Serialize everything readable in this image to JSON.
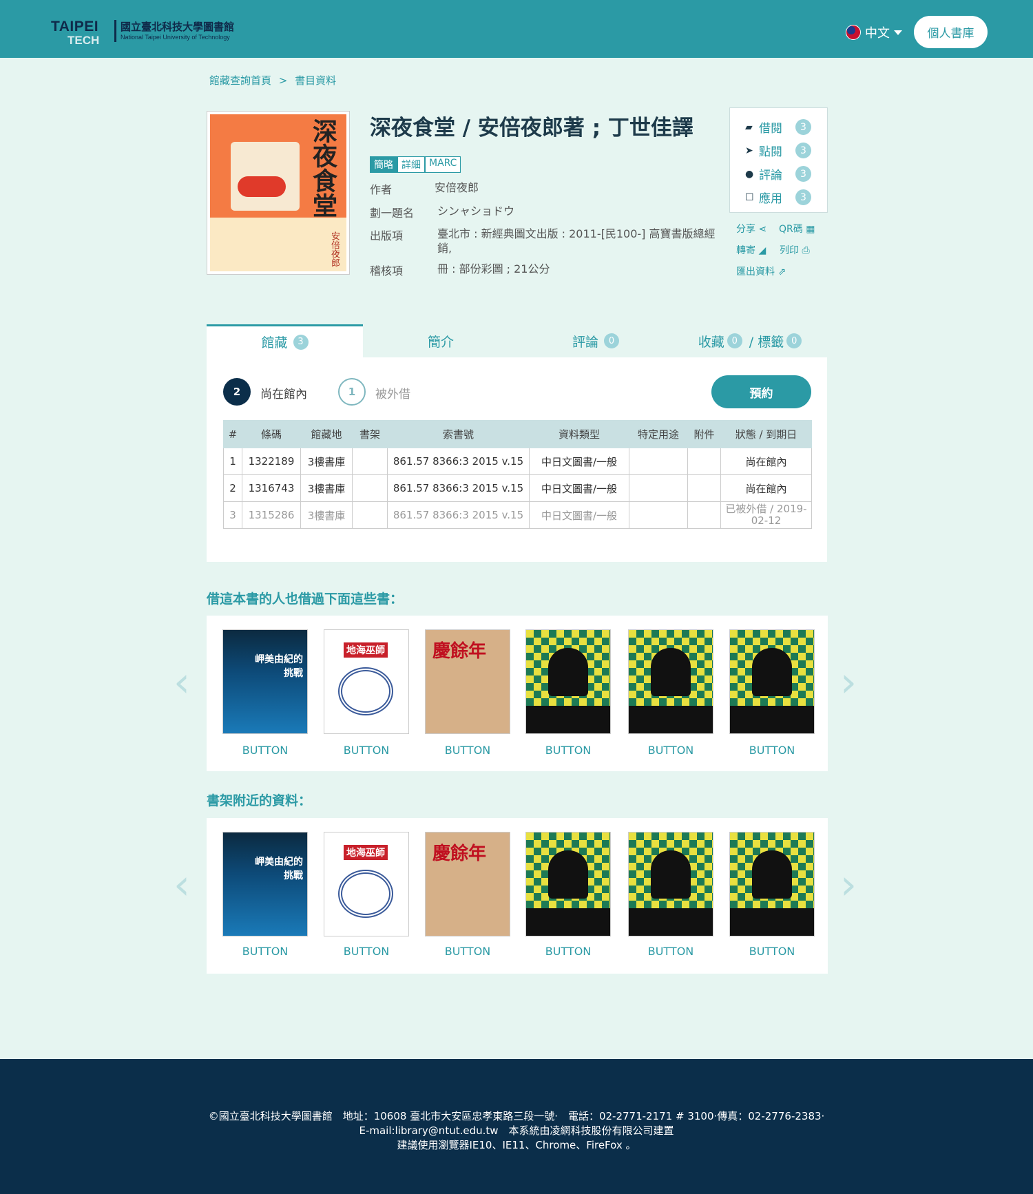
{
  "header": {
    "logo_text": "TAIPEI",
    "logo_text2": "TECH",
    "logo_zh": "國立臺北科技大學圖書館",
    "logo_en": "National Taipei University of Technology",
    "lang": "中文",
    "my_library": "個人書庫"
  },
  "breadcrumb": {
    "home": "館藏查詢首頁",
    "sep": ">",
    "current": "書目資料"
  },
  "book": {
    "cover_title": "深夜食堂",
    "cover_author": "安倍夜郎",
    "title": "深夜食堂 / 安倍夜郎著 ; 丁世佳譯",
    "view_tabs": [
      "簡略",
      "詳細",
      "MARC"
    ],
    "fields": [
      {
        "key": "作者",
        "value": "安倍夜郎"
      },
      {
        "key": "劃一題名",
        "value": "シンャショドウ"
      },
      {
        "key": "出版項",
        "value": "臺北市 : 新經典圖文出版 : 2011-[民100-] 高寶書版總經銷,"
      },
      {
        "key": "稽核項",
        "value": "冊 : 部份彩圖 ; 21公分"
      }
    ]
  },
  "side_stats": [
    {
      "label": "借閱",
      "count": "3",
      "icon": "book-icon"
    },
    {
      "label": "點閱",
      "count": "3",
      "icon": "cursor-icon"
    },
    {
      "label": "評論",
      "count": "3",
      "icon": "comment-icon"
    },
    {
      "label": "應用",
      "count": "3",
      "icon": "square-icon"
    }
  ],
  "actions": {
    "share": "分享",
    "qr": "QR碼",
    "forward": "轉寄",
    "print": "列印",
    "export": "匯出資料"
  },
  "tabs": [
    {
      "label": "館藏",
      "count": "3"
    },
    {
      "label": "簡介",
      "count": ""
    },
    {
      "label": "評論",
      "count": "0"
    },
    {
      "label": "收藏",
      "count": "0",
      "label2": "/ 標籤",
      "count2": "0"
    }
  ],
  "holdings": {
    "in_count": "2",
    "in_label": "尚在館內",
    "out_count": "1",
    "out_label": "被外借",
    "reserve": "預約",
    "columns": [
      "#",
      "條碼",
      "館藏地",
      "書架",
      "索書號",
      "資料類型",
      "特定用途",
      "附件",
      "狀態 / 到期日"
    ],
    "rows": [
      [
        "1",
        "1322189",
        "3樓書庫",
        "",
        "861.57 8366:3 2015 v.15",
        "中日文圖書/一般",
        "",
        "",
        "尚在館內"
      ],
      [
        "2",
        "1316743",
        "3樓書庫",
        "",
        "861.57 8366:3 2015 v.15",
        "中日文圖書/一般",
        "",
        "",
        "尚在館內"
      ],
      [
        "3",
        "1315286",
        "3樓書庫",
        "",
        "861.57 8366:3 2015 v.15",
        "中日文圖書/一般",
        "",
        "",
        "已被外借 / 2019-02-12"
      ]
    ]
  },
  "also_borrowed": {
    "title": "借這本書的人也借過下面這些書：",
    "items": [
      "BUTTON",
      "BUTTON",
      "BUTTON",
      "BUTTON",
      "BUTTON",
      "BUTTON"
    ]
  },
  "nearby": {
    "title": "書架附近的資料：",
    "items": [
      "BUTTON",
      "BUTTON",
      "BUTTON",
      "BUTTON",
      "BUTTON",
      "BUTTON"
    ]
  },
  "book_covers": {
    "b1": "岬美由紀的挑戰",
    "b2": "地海巫師",
    "b3": "慶餘年",
    "b4": ""
  },
  "footer": {
    "line1": "©國立臺北科技大學圖書館　地址：10608 臺北市大安區忠孝東路三段一號‧　電話：02-2771-2171 # 3100‧傳真：02-2776-2383‧",
    "line2": "E-mail:library@ntut.edu.tw　本系統由凌網科技股份有限公司建置",
    "line3": "建議使用瀏覽器IE10、IE11、Chrome、FireFox 。"
  }
}
